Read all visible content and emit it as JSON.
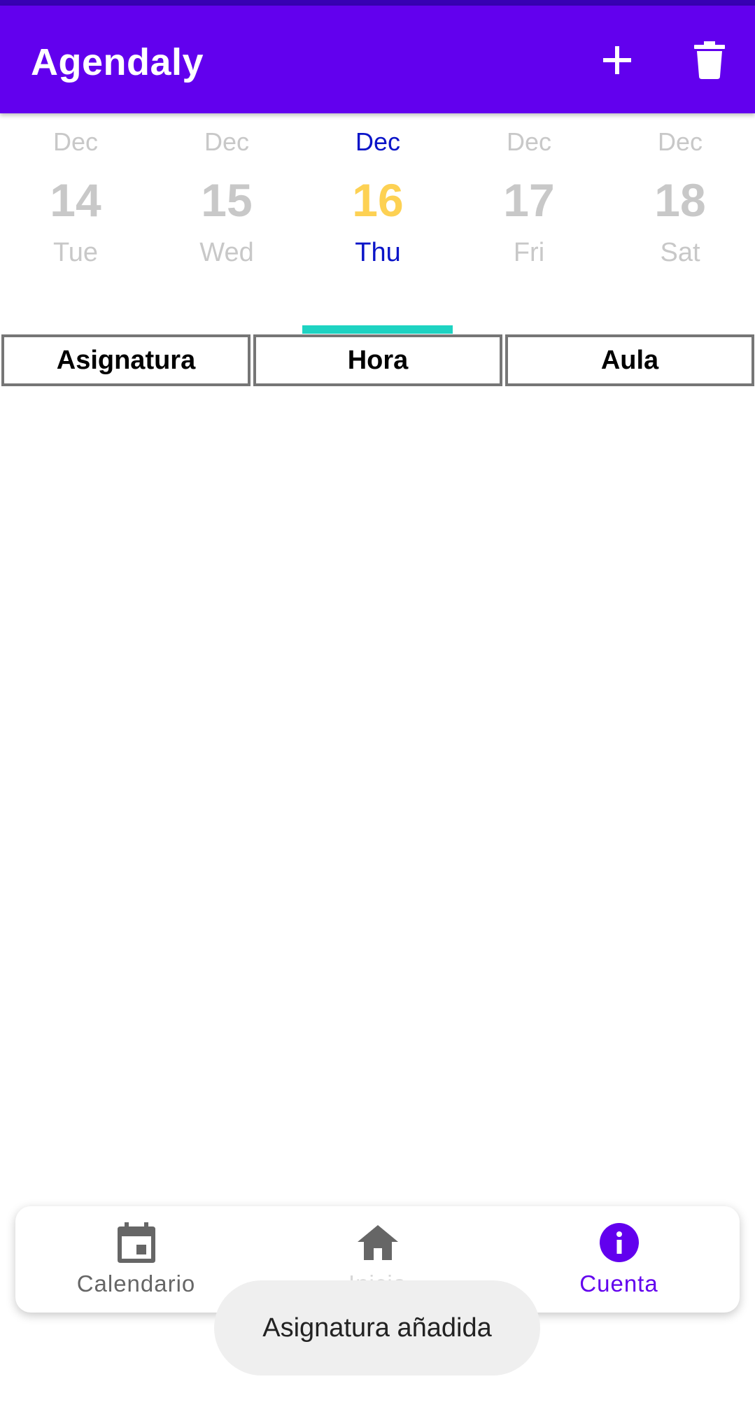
{
  "app_bar": {
    "title": "Agendaly",
    "actions": [
      {
        "icon": "plus-icon"
      },
      {
        "icon": "trash-icon"
      }
    ],
    "background": "#6200ee"
  },
  "date_strip": {
    "selected_index": 2,
    "selected_month_color": "#0a14c8",
    "selected_day_color": "#fdd153",
    "indicator_color": "#1ed3c2",
    "days": [
      {
        "month": "Dec",
        "day": "14",
        "weekday": "Tue"
      },
      {
        "month": "Dec",
        "day": "15",
        "weekday": "Wed"
      },
      {
        "month": "Dec",
        "day": "16",
        "weekday": "Thu"
      },
      {
        "month": "Dec",
        "day": "17",
        "weekday": "Fri"
      },
      {
        "month": "Dec",
        "day": "18",
        "weekday": "Sat"
      }
    ]
  },
  "table": {
    "headers": [
      "Asignatura",
      "Hora",
      "Aula"
    ],
    "rows": []
  },
  "bottom_nav": {
    "items": [
      {
        "label": "Calendario",
        "icon": "calendar-icon"
      },
      {
        "label": "Inicio",
        "icon": "home-icon"
      },
      {
        "label": "Cuenta",
        "icon": "info-icon"
      }
    ],
    "active_index": 2,
    "active_color": "#6200ee"
  },
  "toast": {
    "message": "Asignatura añadida"
  }
}
